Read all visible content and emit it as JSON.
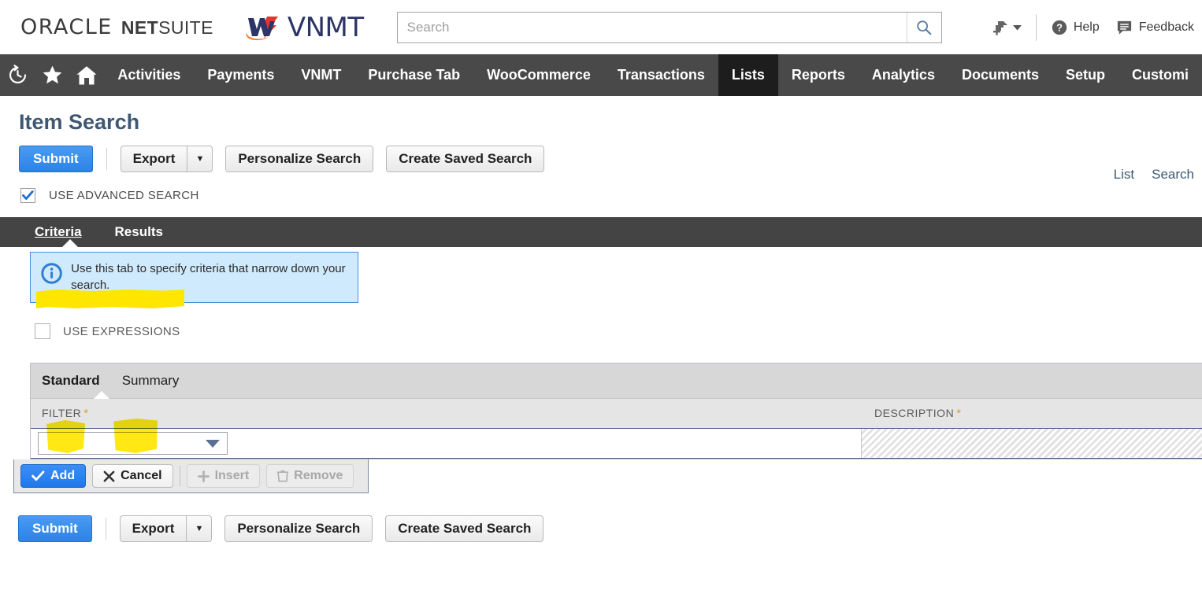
{
  "header": {
    "oracle_brand": "ORACLE",
    "netsuite_bold": "NET",
    "netsuite_light": "SUITE",
    "partner_brand": "VNMT",
    "search_placeholder": "Search",
    "search_value": "",
    "search_icon": "search-icon",
    "create_icon": "create-new-icon",
    "help_label": "Help",
    "help_icon": "question-mark-icon",
    "feedback_label": "Feedback",
    "feedback_icon": "speech-bubble-icon"
  },
  "nav": {
    "icons": [
      "recent-records-icon",
      "favorites-star-icon",
      "home-icon"
    ],
    "items": [
      {
        "label": "Activities",
        "active": false
      },
      {
        "label": "Payments",
        "active": false
      },
      {
        "label": "VNMT",
        "active": false
      },
      {
        "label": "Purchase Tab",
        "active": false
      },
      {
        "label": "WooCommerce",
        "active": false
      },
      {
        "label": "Transactions",
        "active": false
      },
      {
        "label": "Lists",
        "active": true
      },
      {
        "label": "Reports",
        "active": false
      },
      {
        "label": "Analytics",
        "active": false
      },
      {
        "label": "Documents",
        "active": false
      },
      {
        "label": "Setup",
        "active": false
      },
      {
        "label": "Customi",
        "active": false
      }
    ]
  },
  "page": {
    "title": "Item Search",
    "header_links": [
      "List",
      "Search"
    ]
  },
  "toolbar": {
    "submit_label": "Submit",
    "export_label": "Export",
    "export_caret": "▼",
    "personalize_label": "Personalize Search",
    "create_saved_label": "Create Saved Search"
  },
  "advanced_search": {
    "label": "USE ADVANCED SEARCH",
    "checked": true,
    "highlighted": true
  },
  "tabs": [
    {
      "label": "Criteria",
      "accesskey": "C",
      "active": true,
      "highlighted": true
    },
    {
      "label": "Results",
      "accesskey": "R",
      "active": false,
      "highlighted": true
    }
  ],
  "info_note": {
    "icon": "info-circle-icon",
    "text": "Use this tab to specify criteria that narrow down your search."
  },
  "use_expressions": {
    "label": "USE EXPRESSIONS",
    "checked": false
  },
  "criteria_table": {
    "subtabs": [
      {
        "label": "Standard",
        "accesskey": "S",
        "active": true
      },
      {
        "label": "Summary",
        "accesskey": "u",
        "active": false
      }
    ],
    "columns": [
      {
        "label": "FILTER",
        "required": true,
        "required_mark": "*"
      },
      {
        "label": "DESCRIPTION",
        "required": true,
        "required_mark": "*"
      }
    ],
    "row": {
      "filter_value": "",
      "filter_dropdown_icon": "chevron-down-icon",
      "description_value": "",
      "description_disabled": true
    },
    "row_buttons": [
      {
        "label": "Add",
        "icon": "checkmark-icon",
        "style": "primary",
        "disabled": false
      },
      {
        "label": "Cancel",
        "icon": "x-mark-icon",
        "style": "default",
        "disabled": false
      },
      {
        "label": "Insert",
        "icon": "plus-icon",
        "style": "default",
        "disabled": true
      },
      {
        "label": "Remove",
        "icon": "trash-icon",
        "style": "default",
        "disabled": true
      }
    ]
  },
  "colors": {
    "nav_bar": "#494949",
    "nav_active": "#1d1d1d",
    "tab_bar": "#444444",
    "primary_button": "#2c82e8",
    "title_text": "#3f5872",
    "info_background": "#cfeafc",
    "info_border": "#4a90d9",
    "highlight_marker": "#ffe600",
    "required_asterisk": "#e09e2b"
  }
}
